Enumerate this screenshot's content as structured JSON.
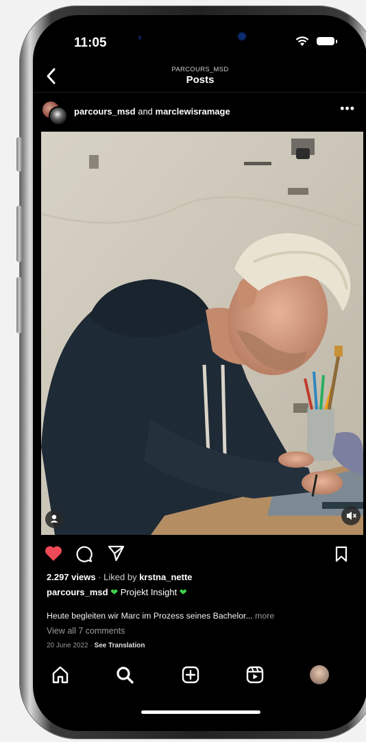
{
  "status_bar": {
    "time": "11:05"
  },
  "header": {
    "subtitle": "PARCOURS_MSD",
    "title": "Posts"
  },
  "post": {
    "author": "parcours_msd",
    "connector": "and",
    "coauthor": "marclewisramage",
    "stats": {
      "views": "2.297 views",
      "separator": "·",
      "liked_prefix": "Liked by",
      "liked_user": "krstna_nette"
    },
    "caption": {
      "user": "parcours_msd",
      "title": "Projekt Insight",
      "text": "Heute begleiten wir Marc im Prozess seines Bachelor...",
      "more": "more"
    },
    "comments_link": "View all 7 comments",
    "date": "20 June 2022",
    "date_separator": "·",
    "translation": "See Translation"
  },
  "colors": {
    "like": "#ed4956",
    "emoji_heart": "#3fd34a",
    "background": "#000000"
  },
  "icons": {
    "back": "chevron-left-icon",
    "menu": "more-horizontal-icon",
    "like": "heart-filled-icon",
    "comment": "comment-icon",
    "share": "paper-plane-icon",
    "save": "bookmark-icon",
    "tabs": [
      "home-icon",
      "search-icon",
      "create-icon",
      "reels-icon",
      "profile-avatar"
    ]
  }
}
